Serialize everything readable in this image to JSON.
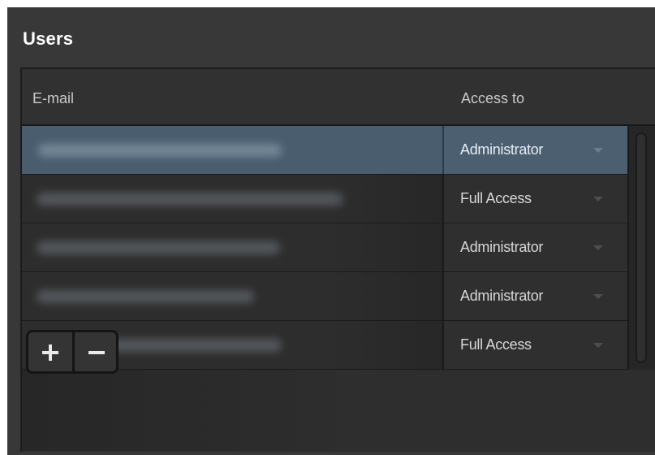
{
  "panel": {
    "title": "Users"
  },
  "table": {
    "columns": {
      "email": "E-mail",
      "access": "Access to"
    },
    "rows": [
      {
        "access": "Administrator",
        "selected": true
      },
      {
        "access": "Full Access",
        "selected": false
      },
      {
        "access": "Administrator",
        "selected": false
      },
      {
        "access": "Administrator",
        "selected": false
      },
      {
        "access": "Full Access",
        "selected": false
      }
    ]
  },
  "toolbar": {
    "add_icon": "plus-icon",
    "remove_icon": "minus-icon"
  },
  "colors": {
    "panel_bg": "#383838",
    "selected_row": "#4a5d6e",
    "text": "#d7d7d7"
  }
}
